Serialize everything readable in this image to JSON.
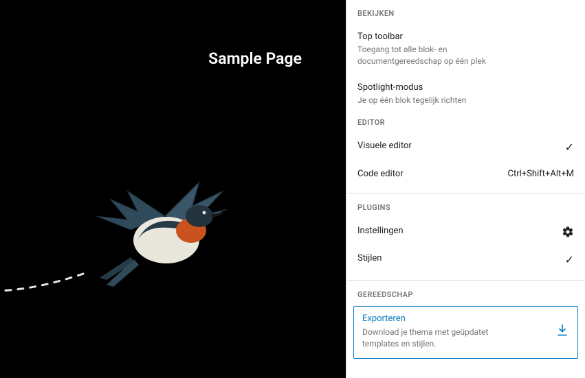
{
  "canvas": {
    "title": "Sample Page"
  },
  "panel": {
    "view": {
      "label": "BEKIJKEN",
      "top_toolbar": {
        "title": "Top toolbar",
        "desc": "Toegang tot alle blok- en documentgereedschap op één plek"
      },
      "spotlight": {
        "title": "Spotlight-modus",
        "desc": "Je op één blok tegelijk richten"
      }
    },
    "editor": {
      "label": "EDITOR",
      "visual": {
        "title": "Visuele editor"
      },
      "code": {
        "title": "Code editor",
        "shortcut": "Ctrl+Shift+Alt+M"
      }
    },
    "plugins": {
      "label": "PLUGINS",
      "settings": {
        "title": "Instellingen"
      },
      "styles": {
        "title": "Stijlen"
      }
    },
    "tools": {
      "label": "GEREEDSCHAP",
      "export": {
        "title": "Exporteren",
        "desc": "Download je thema met geüpdatet templates en stijlen."
      }
    }
  }
}
